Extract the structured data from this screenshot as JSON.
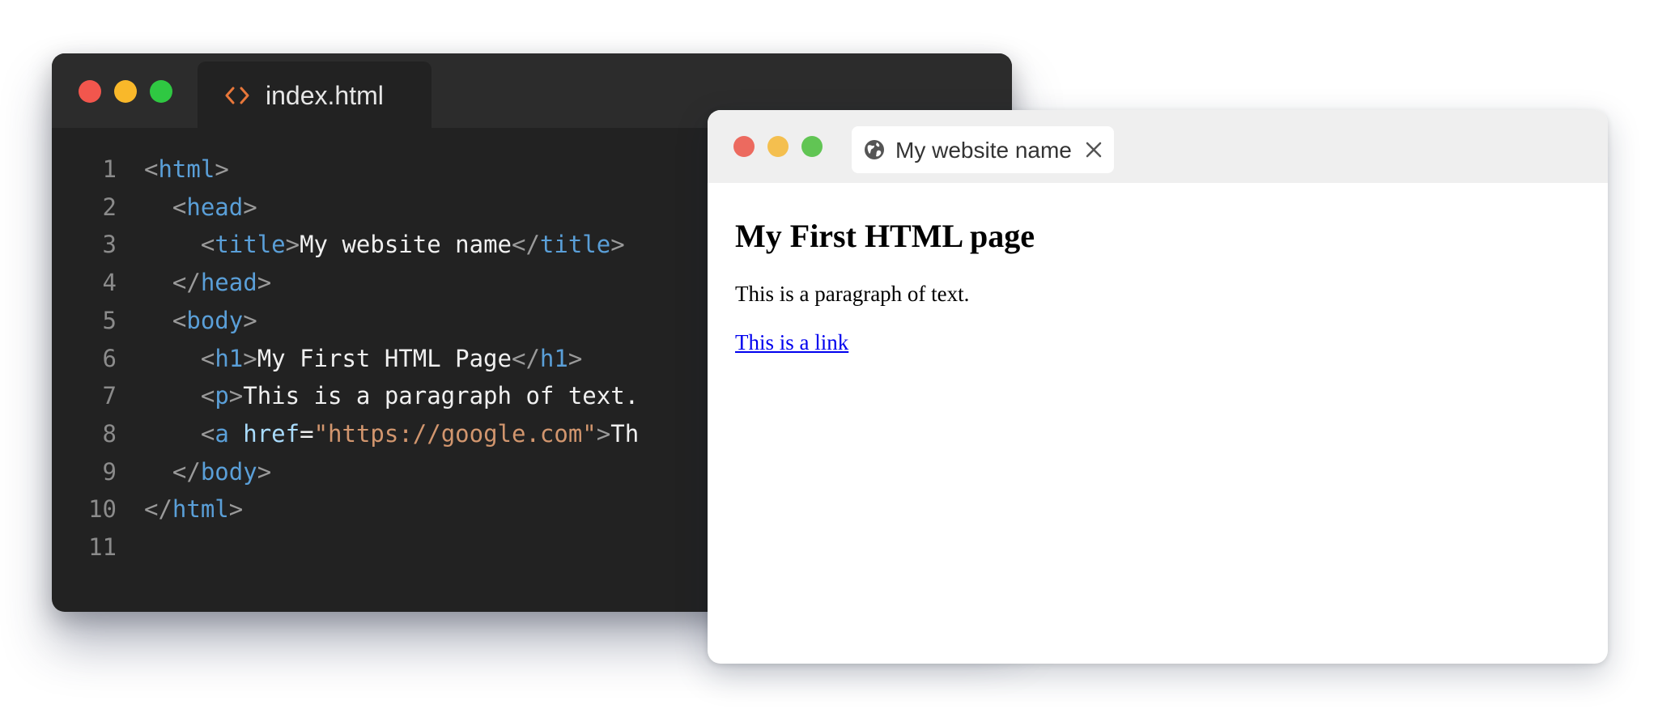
{
  "editor": {
    "tab": {
      "label": "index.html",
      "icon": "code-icon"
    },
    "lines": [
      {
        "num": "1",
        "indent": "",
        "tokens": [
          [
            "p",
            "<"
          ],
          [
            "t",
            "html"
          ],
          [
            "p",
            ">"
          ]
        ]
      },
      {
        "num": "2",
        "indent": "  ",
        "tokens": [
          [
            "p",
            "<"
          ],
          [
            "t",
            "head"
          ],
          [
            "p",
            ">"
          ]
        ]
      },
      {
        "num": "3",
        "indent": "    ",
        "tokens": [
          [
            "p",
            "<"
          ],
          [
            "t",
            "title"
          ],
          [
            "p",
            ">"
          ],
          [
            "x",
            "My website name"
          ],
          [
            "p",
            "</"
          ],
          [
            "t",
            "title"
          ],
          [
            "p",
            ">"
          ]
        ]
      },
      {
        "num": "4",
        "indent": "  ",
        "tokens": [
          [
            "p",
            "</"
          ],
          [
            "t",
            "head"
          ],
          [
            "p",
            ">"
          ]
        ]
      },
      {
        "num": "5",
        "indent": "  ",
        "tokens": [
          [
            "p",
            "<"
          ],
          [
            "t",
            "body"
          ],
          [
            "p",
            ">"
          ]
        ]
      },
      {
        "num": "6",
        "indent": "    ",
        "tokens": [
          [
            "p",
            "<"
          ],
          [
            "t",
            "h1"
          ],
          [
            "p",
            ">"
          ],
          [
            "x",
            "My First HTML Page"
          ],
          [
            "p",
            "</"
          ],
          [
            "t",
            "h1"
          ],
          [
            "p",
            ">"
          ]
        ]
      },
      {
        "num": "7",
        "indent": "    ",
        "tokens": [
          [
            "p",
            "<"
          ],
          [
            "t",
            "p"
          ],
          [
            "p",
            ">"
          ],
          [
            "x",
            "This is a paragraph of text."
          ]
        ]
      },
      {
        "num": "8",
        "indent": "    ",
        "tokens": [
          [
            "p",
            "<"
          ],
          [
            "t",
            "a"
          ],
          [
            "x",
            " "
          ],
          [
            "a",
            "href"
          ],
          [
            "x",
            "="
          ],
          [
            "s",
            "\"https://google.com\""
          ],
          [
            "p",
            ">"
          ],
          [
            "x",
            "Th"
          ]
        ]
      },
      {
        "num": "9",
        "indent": "  ",
        "tokens": [
          [
            "p",
            "</"
          ],
          [
            "t",
            "body"
          ],
          [
            "p",
            ">"
          ]
        ]
      },
      {
        "num": "10",
        "indent": "",
        "tokens": [
          [
            "p",
            "</"
          ],
          [
            "t",
            "html"
          ],
          [
            "p",
            ">"
          ]
        ]
      },
      {
        "num": "11",
        "indent": "",
        "tokens": []
      }
    ]
  },
  "browser": {
    "tab": {
      "label": "My website name",
      "icon": "globe-icon",
      "close_icon": "close-icon"
    },
    "page": {
      "heading": "My First HTML page",
      "paragraph": "This is a paragraph of text.",
      "link": "This is a link"
    }
  },
  "colors": {
    "editor_bg": "#222222",
    "editor_bar": "#2c2c2c",
    "tag": "#5a9fd8",
    "punctuation": "#9a9a9a",
    "attribute": "#a9dcfe",
    "string": "#d2966e",
    "code_icon": "#e8773a",
    "link": "#0000ee"
  }
}
